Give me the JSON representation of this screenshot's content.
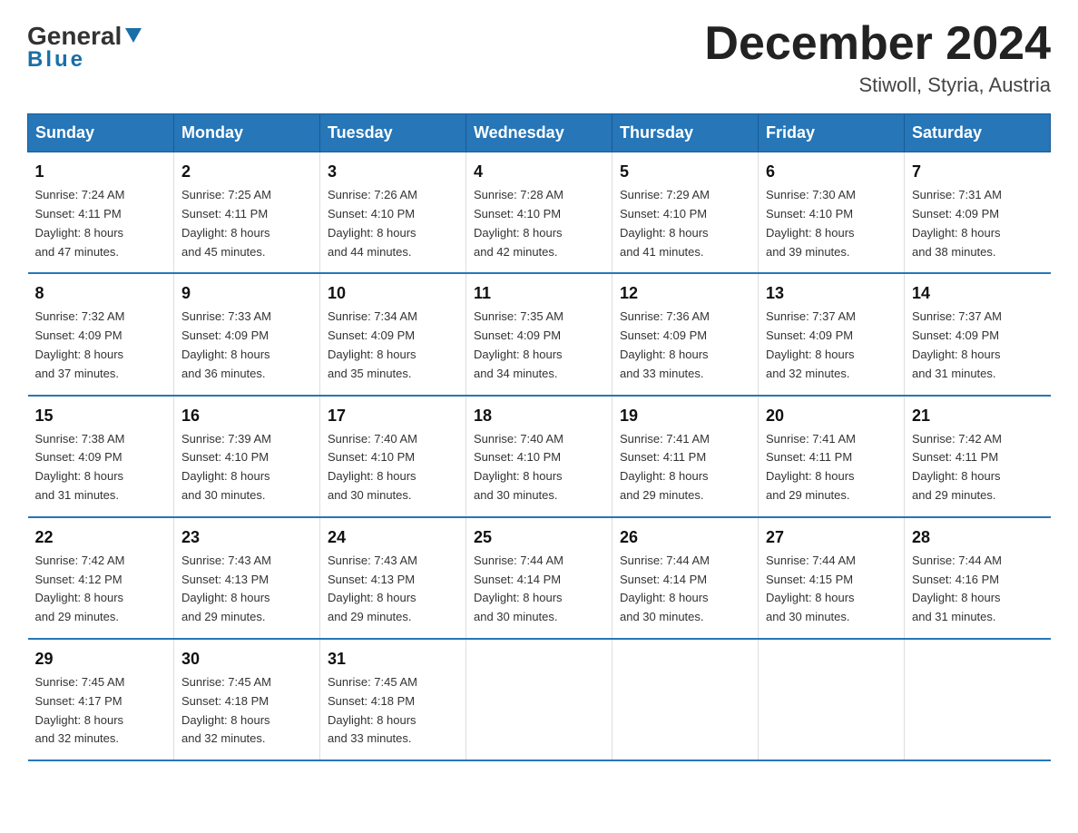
{
  "logo": {
    "general": "General",
    "blue": "Blue"
  },
  "title": "December 2024",
  "location": "Stiwoll, Styria, Austria",
  "days_of_week": [
    "Sunday",
    "Monday",
    "Tuesday",
    "Wednesday",
    "Thursday",
    "Friday",
    "Saturday"
  ],
  "weeks": [
    [
      {
        "day": "1",
        "sunrise": "7:24 AM",
        "sunset": "4:11 PM",
        "daylight": "8 hours and 47 minutes."
      },
      {
        "day": "2",
        "sunrise": "7:25 AM",
        "sunset": "4:11 PM",
        "daylight": "8 hours and 45 minutes."
      },
      {
        "day": "3",
        "sunrise": "7:26 AM",
        "sunset": "4:10 PM",
        "daylight": "8 hours and 44 minutes."
      },
      {
        "day": "4",
        "sunrise": "7:28 AM",
        "sunset": "4:10 PM",
        "daylight": "8 hours and 42 minutes."
      },
      {
        "day": "5",
        "sunrise": "7:29 AM",
        "sunset": "4:10 PM",
        "daylight": "8 hours and 41 minutes."
      },
      {
        "day": "6",
        "sunrise": "7:30 AM",
        "sunset": "4:10 PM",
        "daylight": "8 hours and 39 minutes."
      },
      {
        "day": "7",
        "sunrise": "7:31 AM",
        "sunset": "4:09 PM",
        "daylight": "8 hours and 38 minutes."
      }
    ],
    [
      {
        "day": "8",
        "sunrise": "7:32 AM",
        "sunset": "4:09 PM",
        "daylight": "8 hours and 37 minutes."
      },
      {
        "day": "9",
        "sunrise": "7:33 AM",
        "sunset": "4:09 PM",
        "daylight": "8 hours and 36 minutes."
      },
      {
        "day": "10",
        "sunrise": "7:34 AM",
        "sunset": "4:09 PM",
        "daylight": "8 hours and 35 minutes."
      },
      {
        "day": "11",
        "sunrise": "7:35 AM",
        "sunset": "4:09 PM",
        "daylight": "8 hours and 34 minutes."
      },
      {
        "day": "12",
        "sunrise": "7:36 AM",
        "sunset": "4:09 PM",
        "daylight": "8 hours and 33 minutes."
      },
      {
        "day": "13",
        "sunrise": "7:37 AM",
        "sunset": "4:09 PM",
        "daylight": "8 hours and 32 minutes."
      },
      {
        "day": "14",
        "sunrise": "7:37 AM",
        "sunset": "4:09 PM",
        "daylight": "8 hours and 31 minutes."
      }
    ],
    [
      {
        "day": "15",
        "sunrise": "7:38 AM",
        "sunset": "4:09 PM",
        "daylight": "8 hours and 31 minutes."
      },
      {
        "day": "16",
        "sunrise": "7:39 AM",
        "sunset": "4:10 PM",
        "daylight": "8 hours and 30 minutes."
      },
      {
        "day": "17",
        "sunrise": "7:40 AM",
        "sunset": "4:10 PM",
        "daylight": "8 hours and 30 minutes."
      },
      {
        "day": "18",
        "sunrise": "7:40 AM",
        "sunset": "4:10 PM",
        "daylight": "8 hours and 30 minutes."
      },
      {
        "day": "19",
        "sunrise": "7:41 AM",
        "sunset": "4:11 PM",
        "daylight": "8 hours and 29 minutes."
      },
      {
        "day": "20",
        "sunrise": "7:41 AM",
        "sunset": "4:11 PM",
        "daylight": "8 hours and 29 minutes."
      },
      {
        "day": "21",
        "sunrise": "7:42 AM",
        "sunset": "4:11 PM",
        "daylight": "8 hours and 29 minutes."
      }
    ],
    [
      {
        "day": "22",
        "sunrise": "7:42 AM",
        "sunset": "4:12 PM",
        "daylight": "8 hours and 29 minutes."
      },
      {
        "day": "23",
        "sunrise": "7:43 AM",
        "sunset": "4:13 PM",
        "daylight": "8 hours and 29 minutes."
      },
      {
        "day": "24",
        "sunrise": "7:43 AM",
        "sunset": "4:13 PM",
        "daylight": "8 hours and 29 minutes."
      },
      {
        "day": "25",
        "sunrise": "7:44 AM",
        "sunset": "4:14 PM",
        "daylight": "8 hours and 30 minutes."
      },
      {
        "day": "26",
        "sunrise": "7:44 AM",
        "sunset": "4:14 PM",
        "daylight": "8 hours and 30 minutes."
      },
      {
        "day": "27",
        "sunrise": "7:44 AM",
        "sunset": "4:15 PM",
        "daylight": "8 hours and 30 minutes."
      },
      {
        "day": "28",
        "sunrise": "7:44 AM",
        "sunset": "4:16 PM",
        "daylight": "8 hours and 31 minutes."
      }
    ],
    [
      {
        "day": "29",
        "sunrise": "7:45 AM",
        "sunset": "4:17 PM",
        "daylight": "8 hours and 32 minutes."
      },
      {
        "day": "30",
        "sunrise": "7:45 AM",
        "sunset": "4:18 PM",
        "daylight": "8 hours and 32 minutes."
      },
      {
        "day": "31",
        "sunrise": "7:45 AM",
        "sunset": "4:18 PM",
        "daylight": "8 hours and 33 minutes."
      },
      null,
      null,
      null,
      null
    ]
  ],
  "labels": {
    "sunrise": "Sunrise:",
    "sunset": "Sunset:",
    "daylight": "Daylight:"
  }
}
